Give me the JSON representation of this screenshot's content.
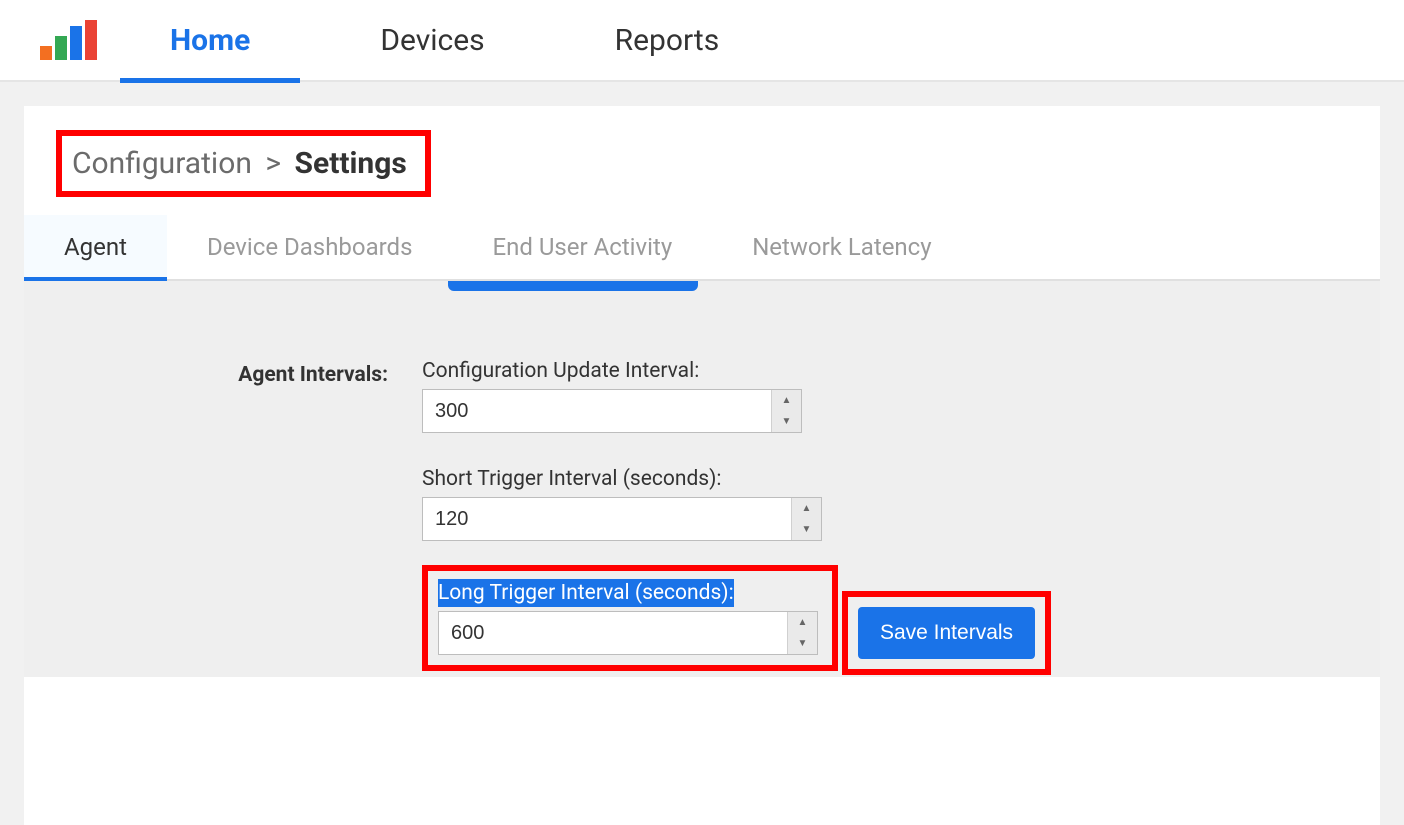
{
  "nav": {
    "home": "Home",
    "devices": "Devices",
    "reports": "Reports"
  },
  "breadcrumb": {
    "parent": "Configuration",
    "separator": ">",
    "current": "Settings"
  },
  "subtabs": {
    "agent": "Agent",
    "device_dashboards": "Device Dashboards",
    "end_user_activity": "End User Activity",
    "network_latency": "Network Latency"
  },
  "section_label": "Agent Intervals:",
  "fields": {
    "config_update": {
      "label": "Configuration Update Interval:",
      "value": "300"
    },
    "short_trigger": {
      "label": "Short Trigger Interval (seconds):",
      "value": "120"
    },
    "long_trigger": {
      "label": "Long Trigger Interval (seconds):",
      "value": "600"
    }
  },
  "buttons": {
    "save_intervals": "Save Intervals"
  }
}
